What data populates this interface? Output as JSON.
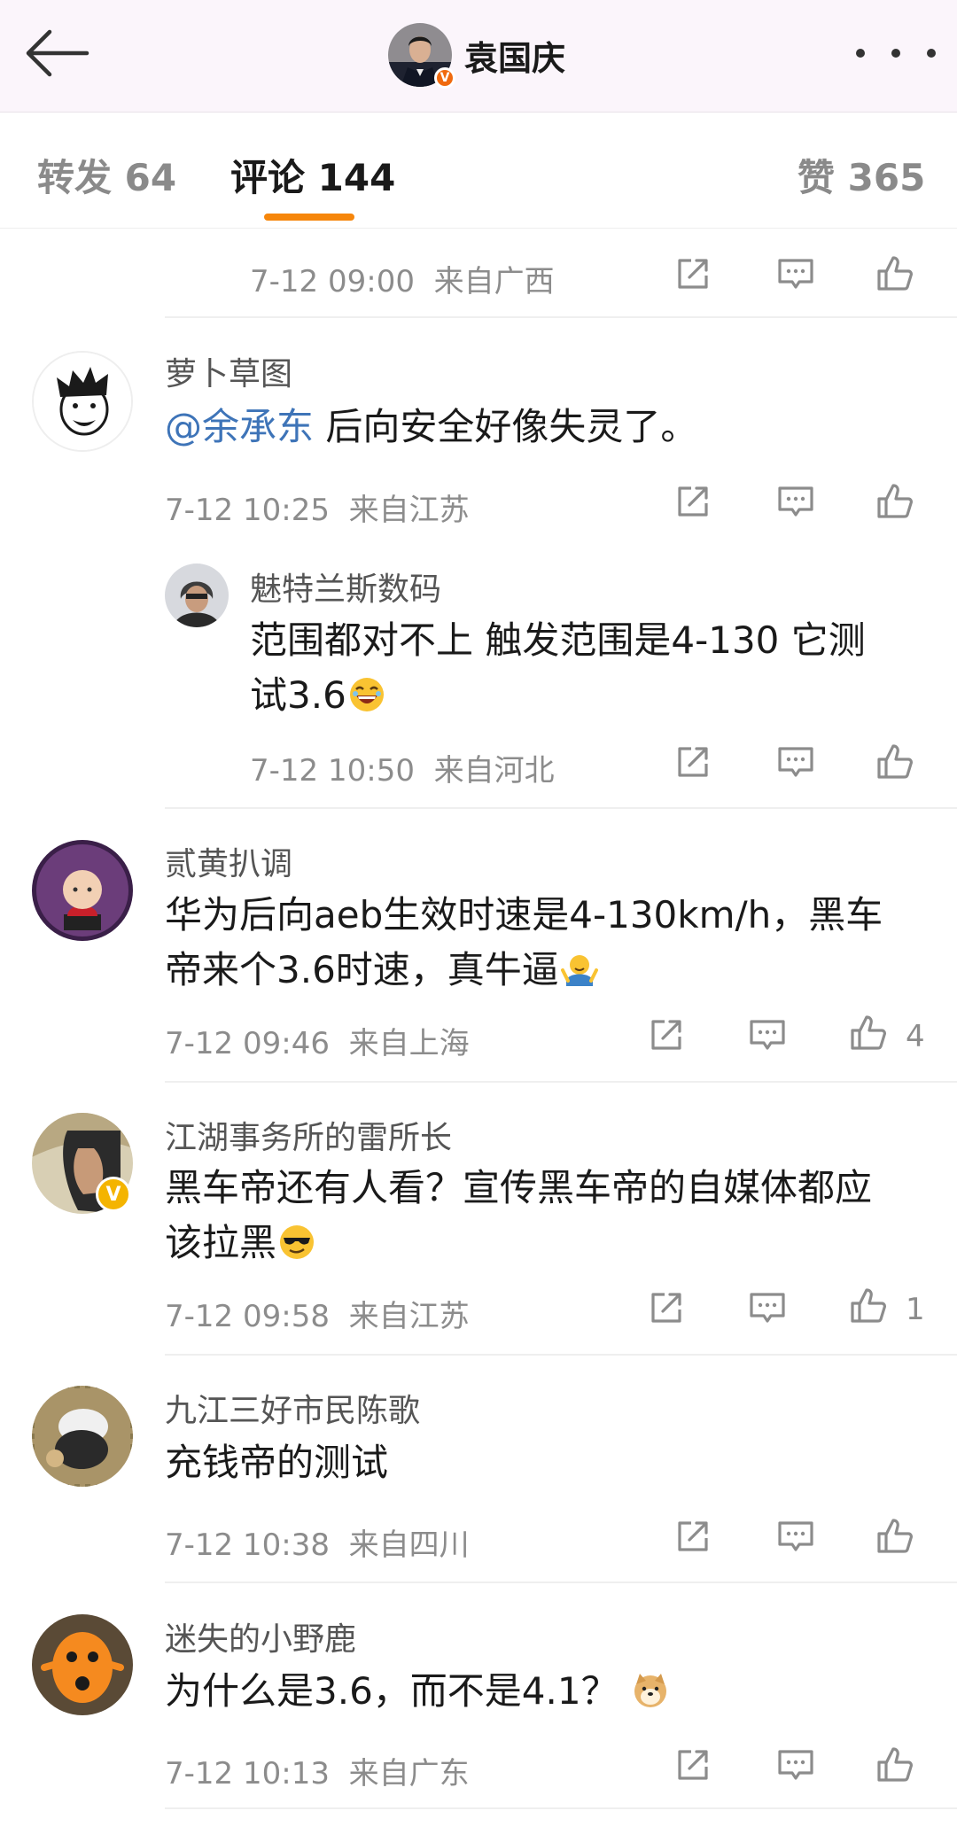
{
  "header": {
    "title": "袁国庆",
    "badge": "V"
  },
  "tabs": [
    {
      "label": "转发 64"
    },
    {
      "label": "评论 144"
    },
    {
      "label": "赞 365"
    }
  ],
  "top_item": {
    "time": "7-12 09:00",
    "location": "来自广西"
  },
  "comments": [
    {
      "user": "萝卜草图",
      "mention": "@余承东",
      "text": " 后向安全好像失灵了。",
      "time": "7-12 10:25",
      "location": "来自江苏"
    },
    {
      "user": "魅特兰斯数码",
      "text_line1": "范围都对不上 触发范围是4-130  它测",
      "text_line2": "试3.6",
      "time": "7-12 10:50",
      "location": "来自河北"
    },
    {
      "user": "贰黄扒调",
      "text_line1": "华为后向aeb生效时速是4-130km/h，黑车",
      "text_line2": "帝来个3.6时速，真牛逼",
      "time": "7-12 09:46",
      "location": "来自上海",
      "likes": "4"
    },
    {
      "user": "江湖事务所的雷所长",
      "badge": "V",
      "text_line1": "黑车帝还有人看？宣传黑车帝的自媒体都应",
      "text_line2": "该拉黑",
      "time": "7-12 09:58",
      "location": "来自江苏",
      "likes": "1"
    },
    {
      "user": "九江三好市民陈歌",
      "text": "充钱帝的测试",
      "time": "7-12 10:38",
      "location": "来自四川"
    },
    {
      "user": "迷失的小野鹿",
      "text": "为什么是3.6，而不是4.1？",
      "time": "7-12 10:13",
      "location": "来自广东"
    }
  ]
}
